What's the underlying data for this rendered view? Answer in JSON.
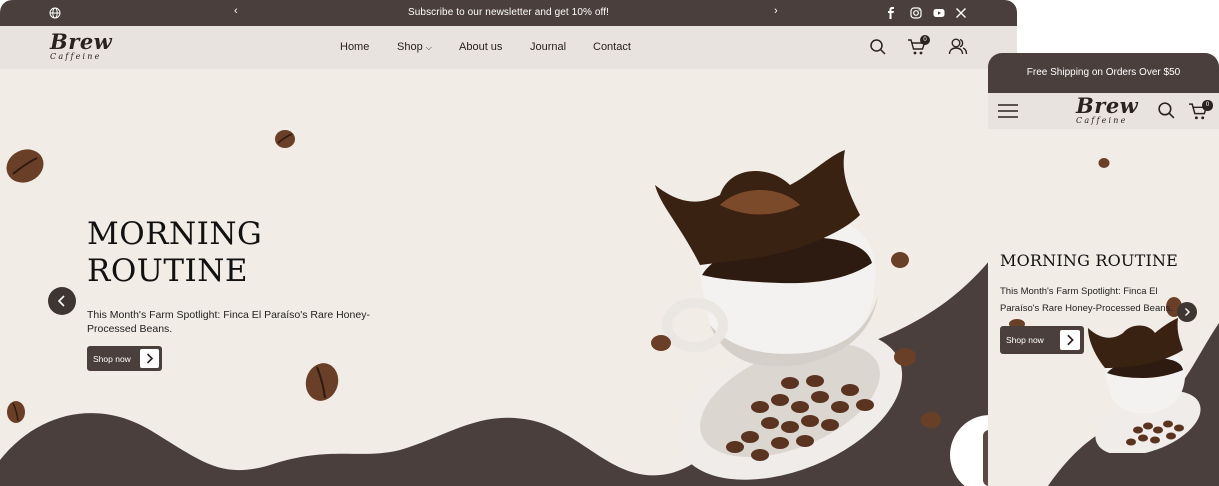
{
  "brand": {
    "name": "Brew",
    "tagline": "Caffeine"
  },
  "announcement": {
    "message": "Subscribe to our newsletter and get 10% off!"
  },
  "nav": {
    "items": [
      {
        "label": "Home"
      },
      {
        "label": "Shop"
      },
      {
        "label": "About us"
      },
      {
        "label": "Journal"
      },
      {
        "label": "Contact"
      }
    ],
    "cart_count": "0"
  },
  "hero": {
    "title_line1": "MORNING",
    "title_line2": "ROUTINE",
    "subtitle": "This Month's Farm Spotlight: Finca El Paraíso's Rare Honey-Processed Beans.",
    "cta_label": "Shop now"
  },
  "mobile": {
    "announcement": "Free Shipping on Orders Over $50",
    "title": "MORNING ROUTINE",
    "subtitle": "This Month's Farm Spotlight: Finca El Paraíso's Rare Honey-Processed Beans.",
    "cta_label": "Shop now",
    "cart_count": "0"
  },
  "colors": {
    "dark_brown": "#4a3f3d",
    "cream": "#f1ece6",
    "nav_bg": "#e8e3de"
  }
}
